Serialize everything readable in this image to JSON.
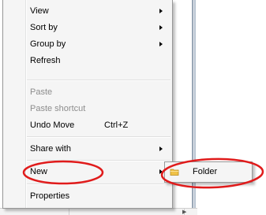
{
  "context_menu": {
    "items": [
      {
        "label": "View",
        "has_submenu": true,
        "enabled": true
      },
      {
        "label": "Sort by",
        "has_submenu": true,
        "enabled": true
      },
      {
        "label": "Group by",
        "has_submenu": true,
        "enabled": true
      },
      {
        "label": "Refresh",
        "has_submenu": false,
        "enabled": true
      },
      {
        "label": "Paste",
        "has_submenu": false,
        "enabled": false
      },
      {
        "label": "Paste shortcut",
        "has_submenu": false,
        "enabled": false
      },
      {
        "label": "Undo Move",
        "shortcut": "Ctrl+Z",
        "has_submenu": false,
        "enabled": true
      },
      {
        "label": "Share with",
        "has_submenu": true,
        "enabled": true
      },
      {
        "label": "New",
        "has_submenu": true,
        "enabled": true,
        "highlighted": true
      },
      {
        "label": "Properties",
        "has_submenu": false,
        "enabled": true
      }
    ]
  },
  "submenu_new": {
    "items": [
      {
        "label": "Folder",
        "icon": "folder-icon",
        "highlighted": true
      }
    ]
  },
  "colors": {
    "menu_bg": "#f5f5f5",
    "menu_border": "#979797",
    "disabled_text": "#8d8d8d",
    "annotation_red": "#e01b1b",
    "folder_yellow": "#f0c248"
  }
}
